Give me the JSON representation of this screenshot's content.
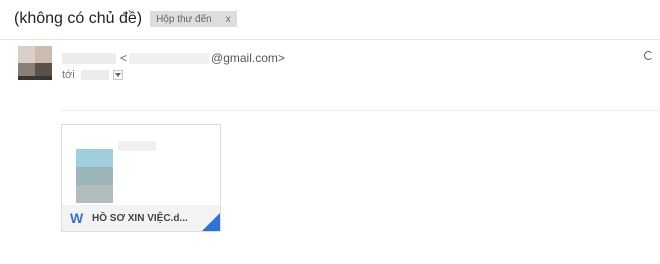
{
  "email": {
    "subject": "(không có chủ đề)",
    "label": {
      "text": "Hộp thư đến",
      "remove": "x"
    }
  },
  "sender": {
    "email_open": "<",
    "email_domain": "@gmail.com>"
  },
  "recipient": {
    "prefix": "tới"
  },
  "attachment": {
    "icon": "W",
    "name": "HỒ SƠ XIN VIỆC.d..."
  },
  "colors": {
    "word_blue": "#3b6fd1",
    "fold_blue": "#2f73d8",
    "label_bg": "#dddddd"
  }
}
